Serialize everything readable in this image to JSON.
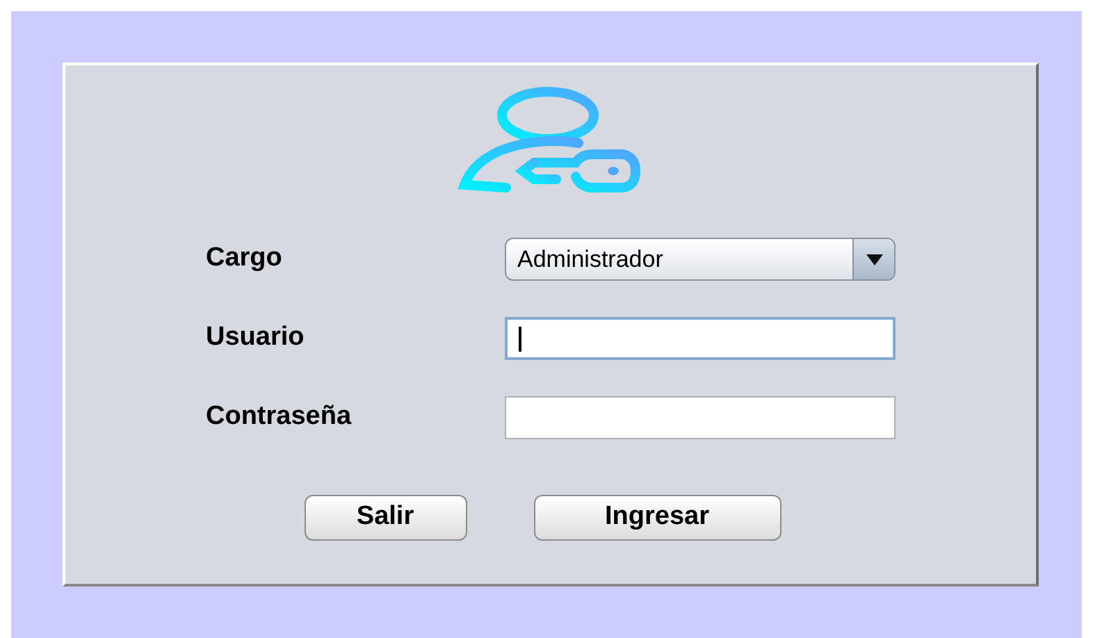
{
  "form": {
    "fields": [
      {
        "kind": "dropdown",
        "label": "Cargo",
        "value": "Administrador"
      },
      {
        "kind": "text",
        "label": "Usuario",
        "focused": true
      },
      {
        "kind": "text",
        "label": "Contraseña",
        "focused": false
      }
    ]
  },
  "buttons": [
    "Salir",
    "Ingresar"
  ]
}
